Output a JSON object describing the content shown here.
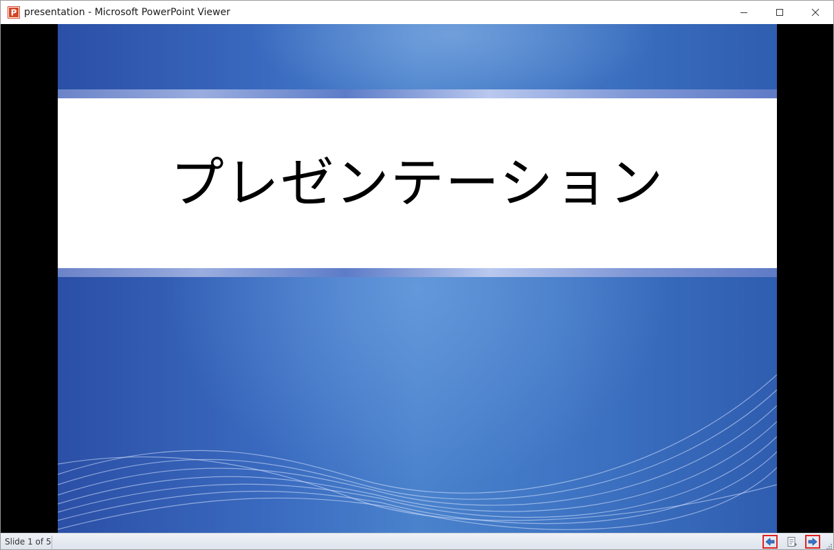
{
  "window": {
    "title": "presentation - Microsoft PowerPoint Viewer",
    "app_icon": "powerpoint-icon",
    "app_icon_letter": "P",
    "controls": [
      "minimize-icon",
      "maximize-icon",
      "close-icon"
    ]
  },
  "slide": {
    "title": "プレゼンテーション"
  },
  "statusbar": {
    "slide_counter": "Slide 1 of 5",
    "buttons": [
      "previous-slide-icon",
      "slide-menu-icon",
      "next-slide-icon"
    ]
  },
  "colors": {
    "accent": "#d24726",
    "slide_blue": "#3a6bc0",
    "highlight_border": "#e02020"
  }
}
